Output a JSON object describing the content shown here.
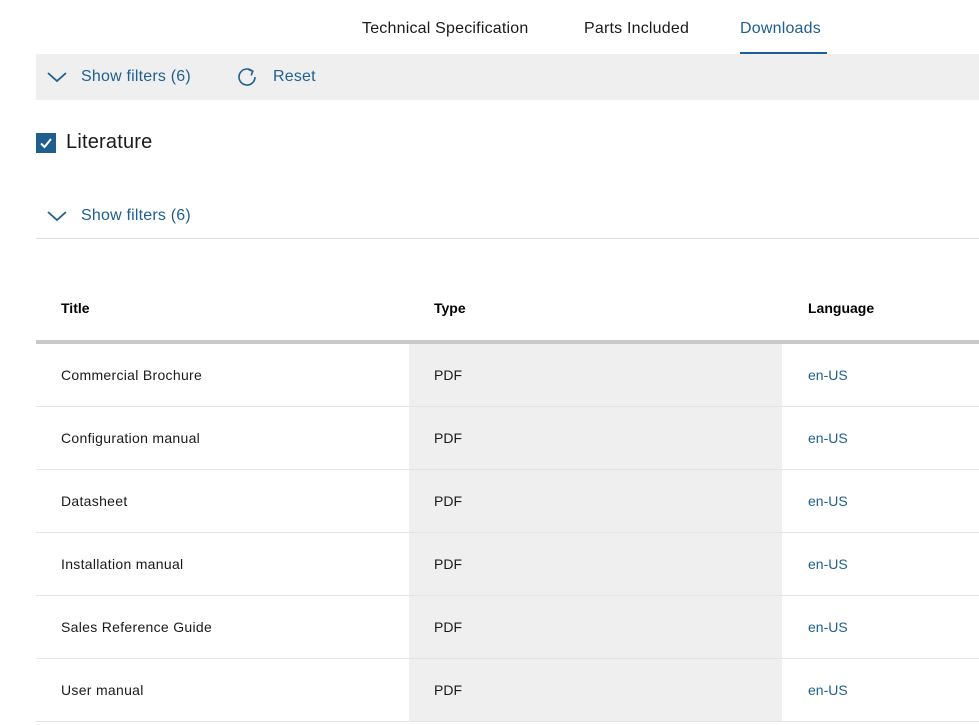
{
  "tabs": [
    {
      "label": "Technical Specification"
    },
    {
      "label": "Parts Included"
    },
    {
      "label": "Downloads",
      "active": true
    }
  ],
  "filterbar": {
    "show_filters": "Show filters (6)",
    "reset": "Reset"
  },
  "literature": {
    "label": "Literature",
    "checked": true
  },
  "filters2": {
    "show_filters": "Show filters (6)"
  },
  "table": {
    "headers": [
      "Title",
      "Type",
      "Language"
    ],
    "rows": [
      [
        "Commercial Brochure",
        "PDF",
        "en-US"
      ],
      [
        "Configuration manual",
        "PDF",
        "en-US"
      ],
      [
        "Datasheet",
        "PDF",
        "en-US"
      ],
      [
        "Installation manual",
        "PDF",
        "en-US"
      ],
      [
        "Sales Reference Guide",
        "PDF",
        "en-US"
      ],
      [
        "User manual",
        "PDF",
        "en-US"
      ]
    ]
  },
  "colors": {
    "accent": "#1f5f8f",
    "filterbar_bg": "#efefef"
  },
  "icons": {
    "chevron": "chevron-down-icon",
    "reset": "refresh-icon",
    "check": "checkmark-icon"
  }
}
